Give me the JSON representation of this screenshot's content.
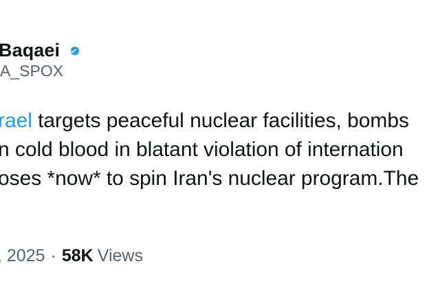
{
  "author": {
    "name": "Baqaei",
    "handle": "A_SPOX",
    "verified_color": "#1d9bf0",
    "verified_icon": "verified-badge-icon"
  },
  "tweet": {
    "line1": {
      "mention": "rael",
      "rest": " targets peaceful nuclear facilities, bombs"
    },
    "line2": "n cold blood in blatant violation of internation",
    "line3": "oses *now* to spin Iran's nuclear program.The"
  },
  "meta": {
    "date": ", 2025",
    "separator": "·",
    "views_count": "58K",
    "views_label": "Views"
  },
  "colors": {
    "text": "#0f1419",
    "secondary": "#536471",
    "accent": "#1d9bf0"
  }
}
